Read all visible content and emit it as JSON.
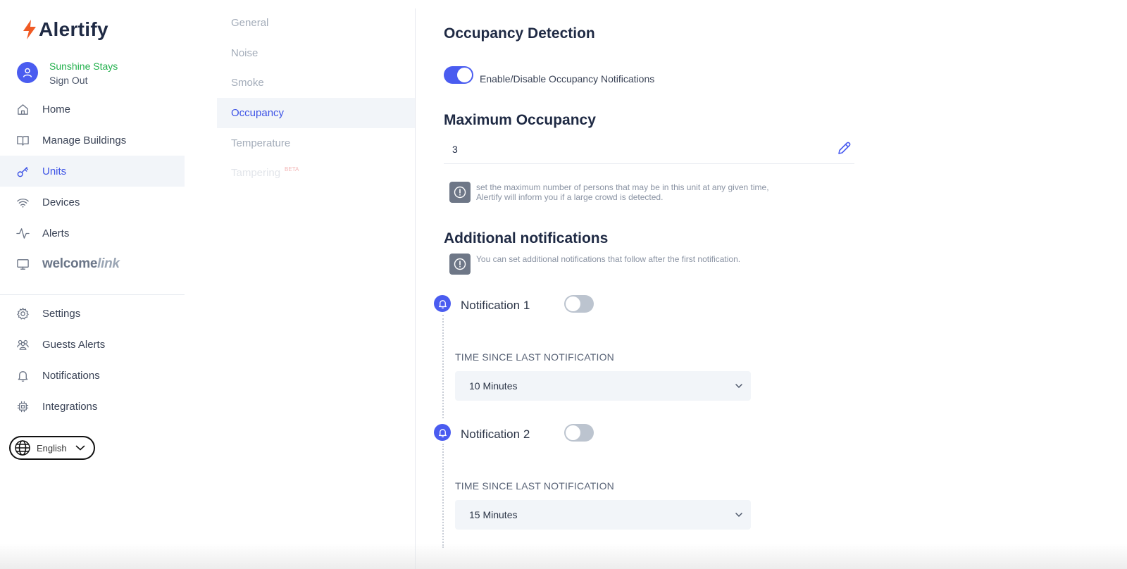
{
  "app": {
    "name": "Alertify",
    "brand_color": "#3e54e6",
    "logo_color": "#f05a24"
  },
  "account": {
    "name": "Sunshine Stays",
    "sign_out": "Sign Out"
  },
  "sidebar": {
    "items": [
      {
        "label": "Home",
        "icon": "home-icon"
      },
      {
        "label": "Manage Buildings",
        "icon": "book-icon"
      },
      {
        "label": "Units",
        "icon": "key-icon",
        "active": true
      },
      {
        "label": "Devices",
        "icon": "wifi-icon"
      },
      {
        "label": "Alerts",
        "icon": "activity-icon"
      }
    ],
    "welcomelink": {
      "part1": "welcome",
      "part2": "link"
    },
    "items2": [
      {
        "label": "Settings",
        "icon": "gear-icon"
      },
      {
        "label": "Guests Alerts",
        "icon": "users-icon"
      },
      {
        "label": "Notifications",
        "icon": "bell-icon"
      },
      {
        "label": "Integrations",
        "icon": "chip-icon"
      }
    ],
    "language": "English"
  },
  "subnav": {
    "items": [
      {
        "label": "General"
      },
      {
        "label": "Noise"
      },
      {
        "label": "Smoke"
      },
      {
        "label": "Occupancy",
        "active": true
      },
      {
        "label": "Temperature"
      },
      {
        "label": "Tampering",
        "badge": "BETA",
        "disabled": true
      }
    ]
  },
  "main": {
    "occupancy_title": "Occupancy Detection",
    "enable_toggle": {
      "label": "Enable/Disable Occupancy Notifications",
      "on": true
    },
    "max_title": "Maximum Occupancy",
    "max_value": "3",
    "max_info_line1": "set the maximum number of persons that may be in this unit at any given time,",
    "max_info_line2": "Alertify will inform you if a large crowd is detected.",
    "additional_title": "Additional notifications",
    "additional_info": "You can set additional notifications that follow after the first notification.",
    "notifications": [
      {
        "label": "Notification 1",
        "on": false,
        "field_label": "TIME SINCE LAST NOTIFICATION",
        "value": "10 Minutes"
      },
      {
        "label": "Notification 2",
        "on": false,
        "field_label": "TIME SINCE LAST NOTIFICATION",
        "value": "15 Minutes"
      }
    ]
  }
}
